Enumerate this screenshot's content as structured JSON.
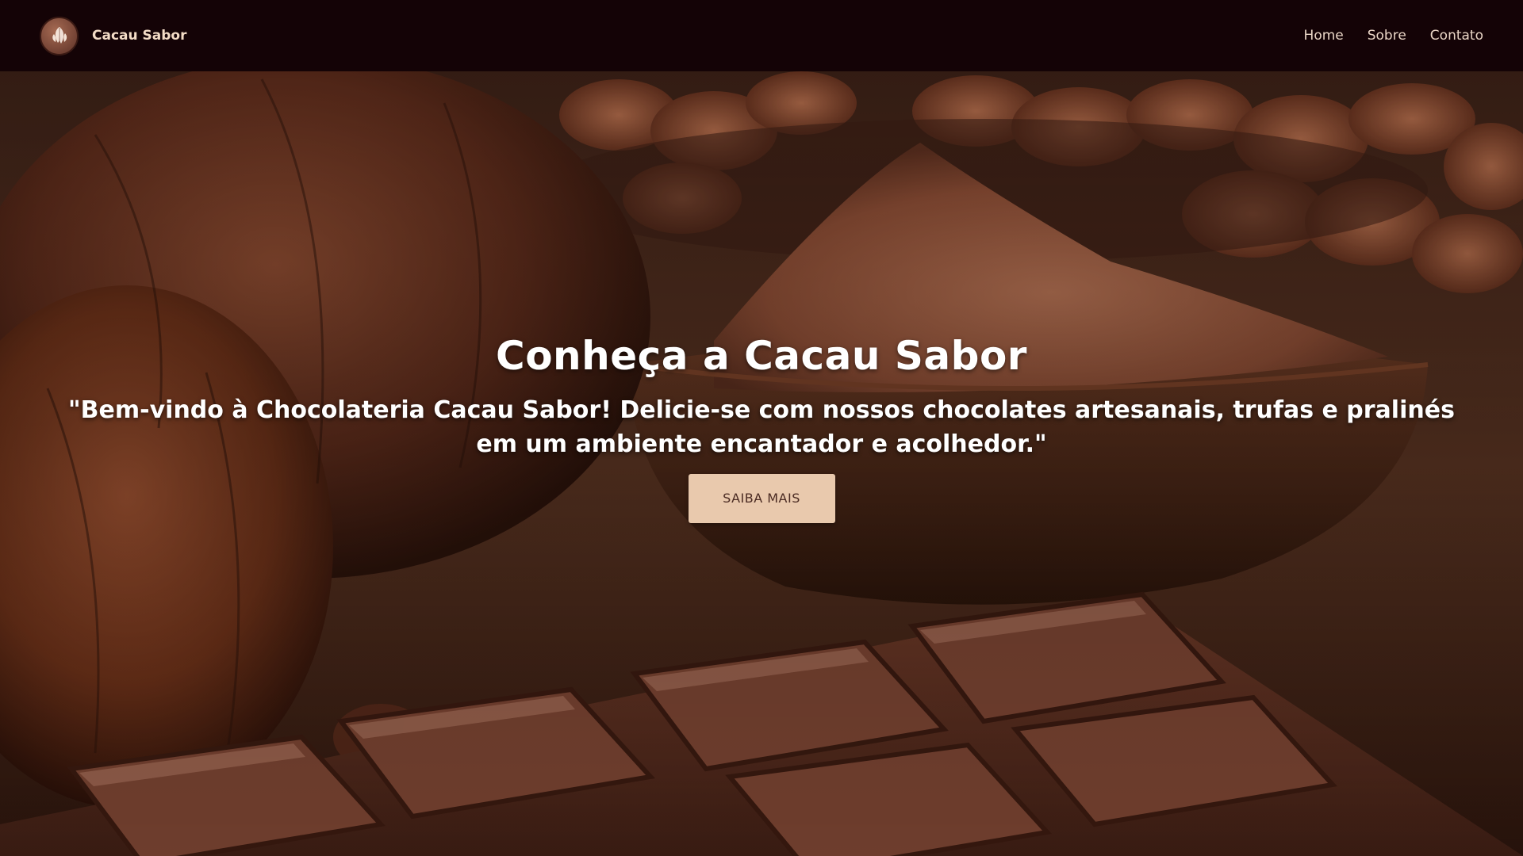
{
  "nav": {
    "brand": "Cacau Sabor",
    "logo_icon": "cacao-pod-logo-icon",
    "links": [
      "Home",
      "Sobre",
      "Contato"
    ]
  },
  "hero": {
    "title": "Conheça a Cacau Sabor",
    "text": "\"Bem-vindo à Chocolateria Cacau Sabor! Delicie-se com nossos chocolates artesanais, trufas e pralinés em um ambiente encantador e acolhedor.\"",
    "cta_label": "SAIBA MAIS"
  },
  "colors": {
    "navbar_bg": "#140306",
    "nav_text": "#ead6c6",
    "button_bg": "#e9c9ad",
    "button_text": "#4a2a22"
  }
}
